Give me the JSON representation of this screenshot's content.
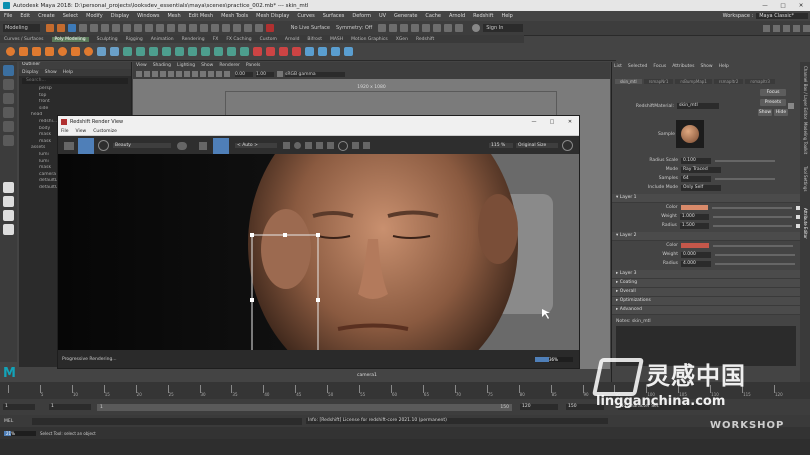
{
  "title_bar": {
    "title": "Autodesk Maya 2018: D:\\personal_projects\\looksdev_essentials\\maya\\scenes\\practice_002.mb* --- skin_mtl",
    "controls": [
      "—",
      "□",
      "✕"
    ]
  },
  "menu_bar": {
    "items": [
      "File",
      "Edit",
      "Create",
      "Select",
      "Modify",
      "Display",
      "Windows",
      "Mesh",
      "Edit Mesh",
      "Mesh Tools",
      "Mesh Display",
      "Curves",
      "Surfaces",
      "Deform",
      "UV",
      "Generate",
      "Cache",
      "Arnold",
      "Redshift",
      "Help"
    ],
    "workspace_label": "Workspace :",
    "workspace_value": "Maya Classic*"
  },
  "status_line": {
    "mode": "Modeling",
    "live_surface": "No Live Surface",
    "symmetry": "Symmetry: Off",
    "sign_in": "Sign In"
  },
  "shelf_tabs": [
    "Curves / Surfaces",
    "Poly Modeling",
    "Sculpting",
    "Rigging",
    "Animation",
    "Rendering",
    "FX",
    "FX Caching",
    "Custom",
    "Arnold",
    "Bifrost",
    "MASH",
    "Motion Graphics",
    "XGen",
    "Redshift"
  ],
  "shelf_active_tab": "Poly Modeling",
  "outliner": {
    "title": "Outliner",
    "menus": [
      "Display",
      "Show",
      "Help"
    ],
    "search_placeholder": "Search...",
    "items": [
      "persp",
      "top",
      "front",
      "side",
      "head",
      "redshi...",
      "body",
      "mask",
      "mask",
      "assets",
      "lumi",
      "lumi",
      "mask",
      "camera",
      "defaultLightSet",
      "defaultObjectSet"
    ]
  },
  "viewport": {
    "menus": [
      "View",
      "Shading",
      "Lighting",
      "Show",
      "Renderer",
      "Panels"
    ],
    "resolution_gate": "1920 x 1080",
    "fields": [
      "0.00",
      "1.00"
    ],
    "color_space": "sRGB gamma"
  },
  "render_view": {
    "title": "Redshift Render View",
    "menus": [
      "File",
      "View",
      "Customize"
    ],
    "aov": "Beauty",
    "auto": "< Auto >",
    "zoom": "115 %",
    "size": "Original Size",
    "status": "Progressive Rendering...",
    "progress_text": "36%",
    "progress": 0.36,
    "camera": "camera1"
  },
  "attribute_editor": {
    "tabs": [
      "List",
      "Selected",
      "Focus",
      "Attributes",
      "Show",
      "Help"
    ],
    "node_tabs": [
      "skin_mtl",
      "rsmapNr1",
      "rsBumpMap1",
      "rsmapItr2",
      "rsmapItr3"
    ],
    "material_label": "RedshiftMaterial:",
    "material_name": "skin_mtl",
    "buttons": [
      "Focus",
      "Presets",
      "Show",
      "Hide"
    ],
    "sample_label": "Sample",
    "params": [
      {
        "label": "Radius Scale",
        "value": "0.100"
      },
      {
        "label": "Mode",
        "value": "Ray Traced"
      },
      {
        "label": "Samples",
        "value": "64"
      },
      {
        "label": "Include Mode",
        "value": "Only Self"
      }
    ],
    "layer1": {
      "title": "Layer 1",
      "color_label": "Color",
      "color": "#d88a6a",
      "weight_label": "Weight",
      "weight": "1.000",
      "radius_label": "Radius",
      "radius": "1.500"
    },
    "layer2": {
      "title": "Layer 2",
      "color_label": "Color",
      "color": "#c4574a",
      "weight_label": "Weight",
      "weight": "0.000",
      "radius_label": "Radius",
      "radius": "4.000"
    },
    "sections": [
      "Layer 3",
      "Coating",
      "Overall",
      "Optimizations",
      "Advanced"
    ],
    "notes_label": "Notes: skin_mtl"
  },
  "side_tabs": [
    "Channel Box / Layer Editor",
    "Attribute Editor",
    "Modeling Toolkit",
    "Tool Settings"
  ],
  "timeline": {
    "ticks": [
      "",
      "5",
      "10",
      "15",
      "20",
      "25",
      "30",
      "35",
      "40",
      "45",
      "50",
      "55",
      "60",
      "65",
      "70",
      "75",
      "80",
      "85",
      "90",
      "95",
      "100",
      "105",
      "110",
      "115",
      "120"
    ],
    "current_frame": "1"
  },
  "range": {
    "start": "1",
    "inner_start": "1",
    "inner_end": "150",
    "end_inner": "120",
    "end": "150",
    "char_set": "No Character Set"
  },
  "command_line": {
    "label": "MEL",
    "output": "Info: [Redshift] License for redshift-core 2021.10 (permanent)"
  },
  "help_line": {
    "progress_text": "21%",
    "text": "Select Tool: select an object"
  },
  "watermark": {
    "cn": "灵感中国",
    "site": "lingganchina.com",
    "sub": "WORKSHOP"
  }
}
